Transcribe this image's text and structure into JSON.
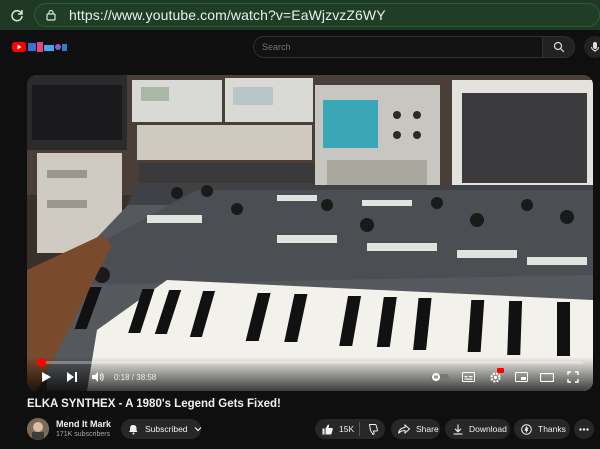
{
  "browser": {
    "url": "https://www.youtube.com/watch?v=EaWjzvzZ6WY"
  },
  "header": {
    "search_placeholder": "Search"
  },
  "player": {
    "progress_fraction": 0.008,
    "time_text": "0:18 / 38:58"
  },
  "video": {
    "title": "ELKA SYNTHEX - A 1980's Legend Gets Fixed!"
  },
  "channel": {
    "name": "Mend It Mark",
    "subscribers": "171K subscribers"
  },
  "actions": {
    "subscribed_label": "Subscribed",
    "like_count": "15K",
    "share_label": "Share",
    "download_label": "Download",
    "thanks_label": "Thanks"
  },
  "colors": {
    "browser_bar": "#1e3a24",
    "youtube_red": "#ff0000",
    "pill_bg": "#272727"
  }
}
